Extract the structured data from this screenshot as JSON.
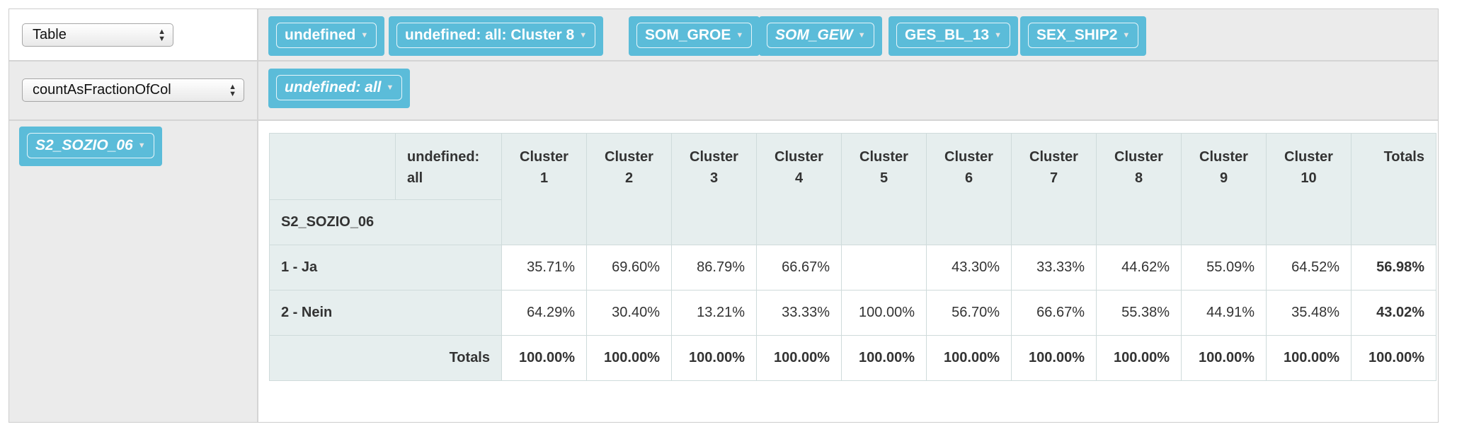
{
  "renderer": {
    "selected": "Table"
  },
  "aggregator": {
    "selected": "countAsFractionOfCol"
  },
  "cols_attrs": [
    "undefined",
    "undefined: all: Cluster 8",
    "SOM_GROE",
    "SOM_GEW",
    "GES_BL_13",
    "SEX_SHIP2"
  ],
  "vals_attr": "undefined: all",
  "rows_attr": "S2_SOZIO_06",
  "table": {
    "col_attr_label": "undefined: all",
    "row_attr_label": "S2_SOZIO_06",
    "clusters": [
      [
        "Cluster",
        "1"
      ],
      [
        "Cluster",
        "2"
      ],
      [
        "Cluster",
        "3"
      ],
      [
        "Cluster",
        "4"
      ],
      [
        "Cluster",
        "5"
      ],
      [
        "Cluster",
        "6"
      ],
      [
        "Cluster",
        "7"
      ],
      [
        "Cluster",
        "8"
      ],
      [
        "Cluster",
        "9"
      ],
      [
        "Cluster",
        "10"
      ]
    ],
    "totals_header": "Totals",
    "rows": [
      {
        "label": "1 - Ja",
        "values": [
          "35.71%",
          "69.60%",
          "86.79%",
          "66.67%",
          "",
          "43.30%",
          "33.33%",
          "44.62%",
          "55.09%",
          "64.52%"
        ],
        "total": "56.98%"
      },
      {
        "label": "2 - Nein",
        "values": [
          "64.29%",
          "30.40%",
          "13.21%",
          "33.33%",
          "100.00%",
          "56.70%",
          "66.67%",
          "55.38%",
          "44.91%",
          "35.48%"
        ],
        "total": "43.02%"
      }
    ],
    "totals_row": {
      "label": "Totals",
      "values": [
        "100.00%",
        "100.00%",
        "100.00%",
        "100.00%",
        "100.00%",
        "100.00%",
        "100.00%",
        "100.00%",
        "100.00%",
        "100.00%"
      ],
      "total": "100.00%"
    }
  }
}
